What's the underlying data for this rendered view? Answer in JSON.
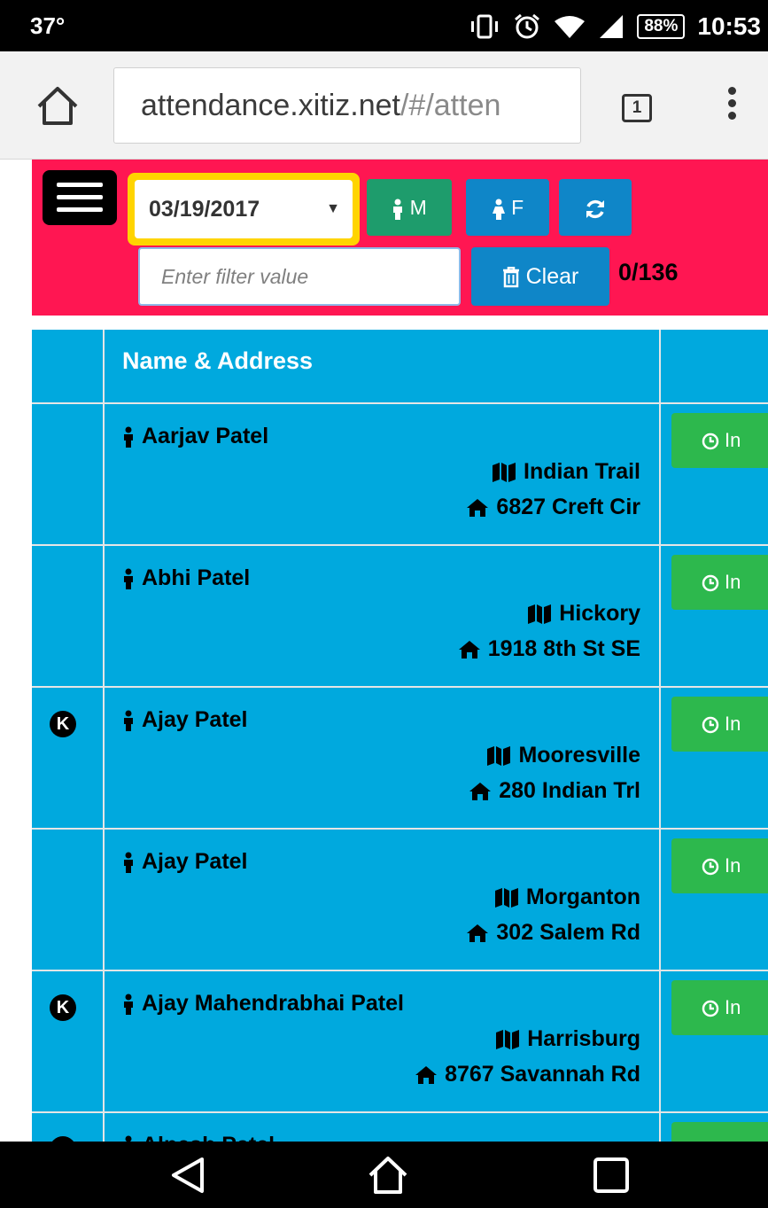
{
  "status_bar": {
    "temperature": "37°",
    "battery": "88%",
    "time": "10:53"
  },
  "browser": {
    "url_main": "attendance.xitiz.net",
    "url_tail": "/#/atten",
    "tab_count": "1"
  },
  "toolbar": {
    "date_value": "03/19/2017",
    "male_label": "M",
    "female_label": "F",
    "filter_placeholder": "Enter filter value",
    "filter_value": "",
    "clear_label": "Clear",
    "count_text": "0/136"
  },
  "table": {
    "header": "Name & Address",
    "in_label": "In",
    "rows": [
      {
        "badge": "",
        "name": "Aarjav Patel",
        "city": "Indian Trail",
        "street": "6827 Creft Cir"
      },
      {
        "badge": "",
        "name": "Abhi Patel",
        "city": "Hickory",
        "street": "1918 8th St SE"
      },
      {
        "badge": "K",
        "name": "Ajay Patel",
        "city": "Mooresville",
        "street": "280 Indian Trl"
      },
      {
        "badge": "",
        "name": "Ajay Patel",
        "city": "Morganton",
        "street": "302 Salem Rd"
      },
      {
        "badge": "K",
        "name": "Ajay Mahendrabhai Patel",
        "city": "Harrisburg",
        "street": "8767 Savannah Rd"
      },
      {
        "badge": "K",
        "name": "Alpesh Patel",
        "city": "",
        "street": ""
      }
    ]
  },
  "colors": {
    "toolbar": "#ff1652",
    "table": "#00a9de",
    "in_button": "#2db84d",
    "primary_button": "#0f86c8",
    "male_button": "#1e9c6c",
    "date_highlight": "#ffd400"
  },
  "icons": {
    "row_person": "male-person-icon",
    "row_city": "map-icon",
    "row_street": "home-icon",
    "in_button": "clock-icon"
  }
}
